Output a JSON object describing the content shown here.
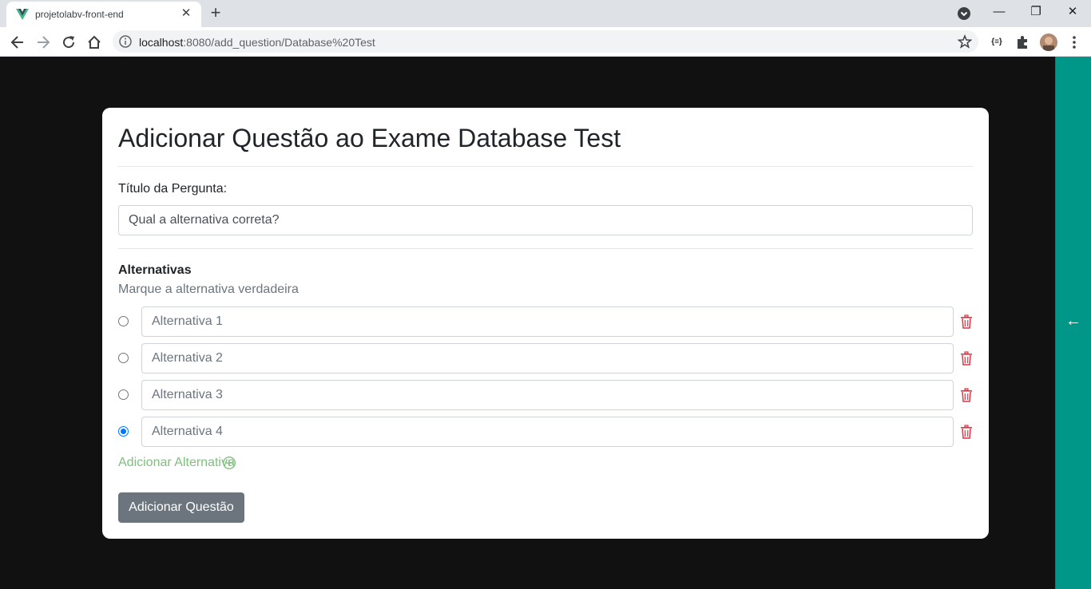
{
  "browser": {
    "tab_title": "projetolabv-front-end",
    "tab_close": "✕",
    "new_tab": "+",
    "url_host": "localhost",
    "url_path": ":8080/add_question/Database%20Test",
    "window_minimize": "—",
    "window_restore": "❐",
    "window_close": "✕",
    "extension_label": "{≡}"
  },
  "page": {
    "title": "Adicionar Questão ao Exame Database Test",
    "question_label": "Título da Pergunta:",
    "question_value": "Qual a alternativa correta?",
    "alternatives_heading": "Alternativas",
    "alternatives_hint": "Marque a alternativa verdadeira",
    "alternatives": [
      {
        "placeholder": "Alternativa 1",
        "checked": false
      },
      {
        "placeholder": "Alternativa 2",
        "checked": false
      },
      {
        "placeholder": "Alternativa 3",
        "checked": false
      },
      {
        "placeholder": "Alternativa 4",
        "checked": true
      }
    ],
    "add_alternative_label": "Adicionar Alternativa",
    "submit_label": "Adicionar Questão"
  },
  "side_panel": {
    "arrow": "←"
  },
  "colors": {
    "page_background": "#111111",
    "card_background": "#ffffff",
    "side_panel": "#009688",
    "trash_icon": "#dc3545",
    "add_alternative": "#7fbf7f",
    "submit_button": "#6c757d",
    "radio_checked": "#0075ff"
  }
}
